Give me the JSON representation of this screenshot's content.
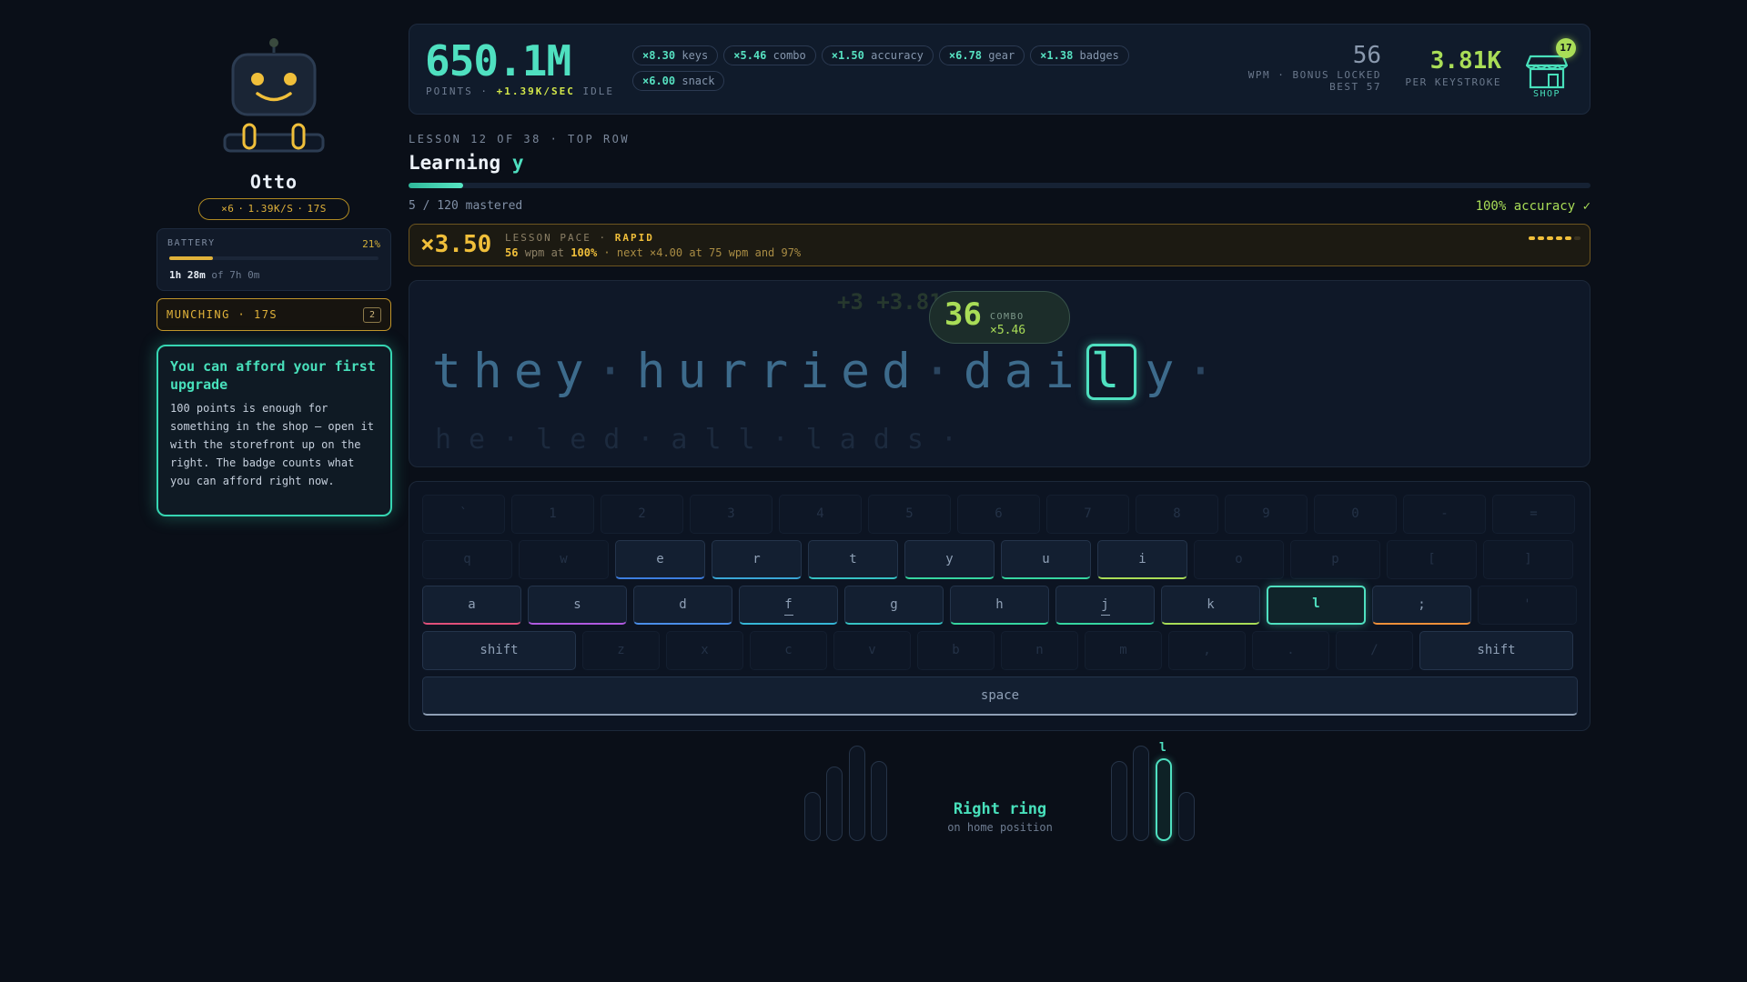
{
  "robot": {
    "name": "Otto",
    "stats": [
      "×6",
      "·",
      "1.39K/S",
      "·",
      "17S"
    ],
    "battery": {
      "label": "BATTERY",
      "percent_text": "21%",
      "level": 0.21,
      "time_main": "1h 28m",
      "time_total": "of 7h 0m"
    },
    "status": {
      "label": "MUNCHING · 17S",
      "count": "2"
    }
  },
  "tip": {
    "title": "You can afford your first upgrade",
    "body": "100 points is enough for something in the shop — open it with the storefront up on the right. The badge counts what you can afford right now."
  },
  "header": {
    "points": "650.1M",
    "points_label": "POINTS ·",
    "points_rate": "+1.39K/SEC",
    "points_idle": "IDLE",
    "multipliers": [
      {
        "value": "×8.30",
        "name": "keys"
      },
      {
        "value": "×5.46",
        "name": "combo"
      },
      {
        "value": "×1.50",
        "name": "accuracy"
      },
      {
        "value": "×6.78",
        "name": "gear"
      },
      {
        "value": "×1.38",
        "name": "badges"
      },
      {
        "value": "×6.00",
        "name": "snack"
      }
    ],
    "wpm": "56",
    "wpm_label": "WPM · BONUS LOCKED",
    "wpm_best": "BEST 57",
    "per_key": "3.81K",
    "per_key_label": "PER KEYSTROKE",
    "shop_label": "SHOP",
    "shop_badge": "17"
  },
  "lesson": {
    "subtitle": "LESSON 12 OF 38 · TOP ROW",
    "title_prefix": "Learning",
    "title_letter": "y",
    "progress": 0.046,
    "mastered": "5 / 120 mastered",
    "accuracy": "100% accuracy ✓"
  },
  "pace": {
    "multiplier": "×3.50",
    "label": "LESSON PACE ·",
    "rating": "RAPID",
    "wpm": "56",
    "wpm_unit": "wpm at",
    "acc": "100%",
    "next": "· next ×4.00 at 75 wpm and 97%",
    "filled": 5,
    "total": 6
  },
  "typing": {
    "floating": "+3 +3.81K",
    "combo": {
      "count": "36",
      "label": "COMBO",
      "mult": "×5.46"
    },
    "typed": "they",
    "word2": "hurried",
    "before_cursor": "dai",
    "cursor": "l",
    "after_cursor": "y",
    "sep": "·",
    "next_line": "he·led·all·lads·"
  },
  "keyboard": {
    "rows": [
      [
        "`",
        "1",
        "2",
        "3",
        "4",
        "5",
        "6",
        "7",
        "8",
        "9",
        "0",
        "-",
        "="
      ],
      [
        "q",
        "w",
        "e",
        "r",
        "t",
        "y",
        "u",
        "i",
        "o",
        "p",
        "[",
        "]"
      ],
      [
        "a",
        "s",
        "d",
        "f",
        "g",
        "h",
        "j",
        "k",
        "l",
        ";",
        "'"
      ],
      [
        "shift",
        "z",
        "x",
        "c",
        "v",
        "b",
        "n",
        "m",
        ",",
        ".",
        "/",
        "shift"
      ],
      [
        "space"
      ]
    ],
    "active": [
      "e",
      "r",
      "t",
      "y",
      "u",
      "i",
      "a",
      "s",
      "d",
      "f",
      "g",
      "h",
      "j",
      "k",
      "l",
      ";",
      "shift",
      "space"
    ],
    "focus": "l",
    "accents": {
      "e": "#3d7ee0",
      "r": "#3aa6d6",
      "t": "#36c2c4",
      "y": "#36d6a0",
      "u": "#36d6a0",
      "i": "#a9dd57",
      "a": "#e0507a",
      "s": "#b05ae0",
      "d": "#4a8ee8",
      "f": "#36b6d6",
      "g": "#36c2c4",
      "h": "#36d6a0",
      "j": "#36d6a0",
      "k": "#a9dd57",
      "l": "#4fe0c0",
      ";": "#f0903a",
      "space": "#8fa0b6"
    }
  },
  "hands": {
    "active_key": "l",
    "finger": "Right ring",
    "position": "on home position"
  }
}
